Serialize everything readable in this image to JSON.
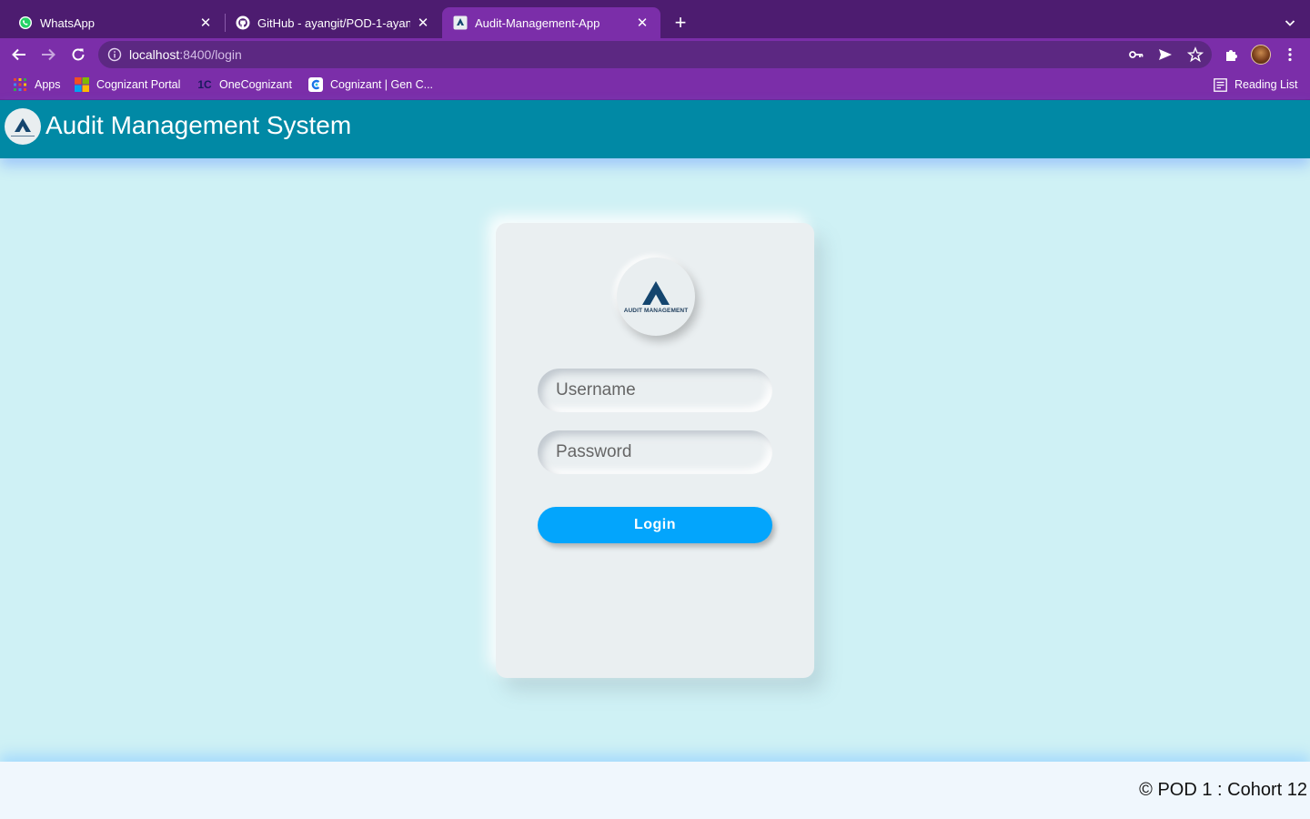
{
  "browser": {
    "tabs": [
      {
        "title": "WhatsApp",
        "icon": "whatsapp-icon",
        "active": false
      },
      {
        "title": "GitHub - ayangit/POD-1-ayan-",
        "icon": "github-icon",
        "active": false
      },
      {
        "title": "Audit-Management-App",
        "icon": "audit-app-icon",
        "active": true
      }
    ],
    "new_tab_label": "+",
    "address": {
      "host": "localhost",
      "path": ":8400/login"
    },
    "bookmarks": [
      {
        "label": "Apps",
        "icon": "apps-grid-icon"
      },
      {
        "label": "Cognizant Portal",
        "icon": "windows-logo-icon"
      },
      {
        "label": "OneCognizant",
        "icon": "onecognizant-icon"
      },
      {
        "label": "Cognizant | Gen C...",
        "icon": "cognizant-genc-icon"
      }
    ],
    "reading_list": "Reading List",
    "colors": {
      "tabstrip": "#4d1c70",
      "toolbar": "#7b2ea9",
      "omnibox": "#5c2882"
    }
  },
  "header": {
    "title": "Audit Management System",
    "background": "#0189a5"
  },
  "login": {
    "logo_text": "AUDIT MANAGEMENT",
    "username_placeholder": "Username",
    "password_placeholder": "Password",
    "button_label": "Login",
    "button_color": "#03a5fc"
  },
  "footer": {
    "text": "© POD 1 : Cohort 12"
  }
}
